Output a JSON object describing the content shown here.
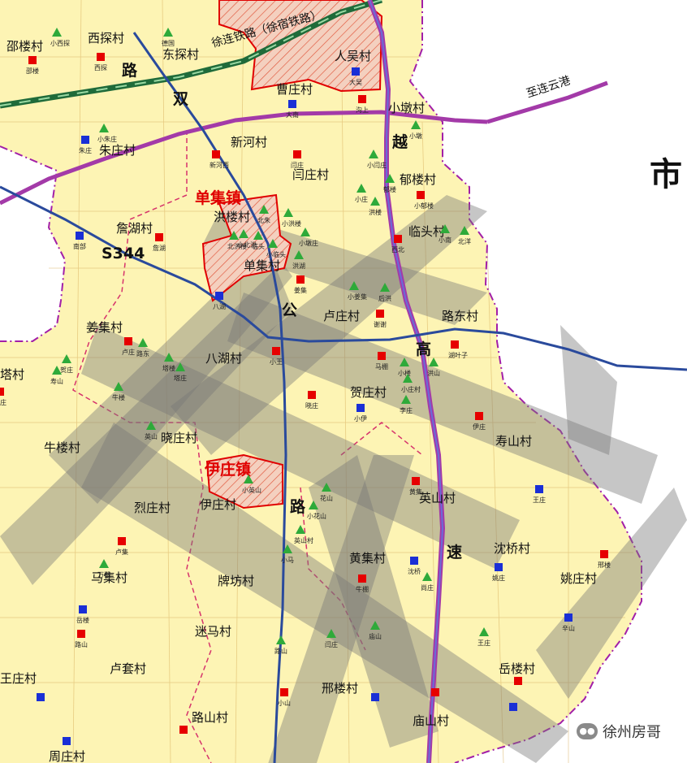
{
  "map": {
    "city_label": "市",
    "road_labels": {
      "shuang": "双",
      "gong1": "公",
      "lu1": "路",
      "gao": "高",
      "su": "速",
      "yue": "越",
      "gong2": "公",
      "lu2": "路",
      "s344": "S344",
      "gangyun": "至连云港",
      "railway": "徐连铁路（徐宿铁路）"
    },
    "towns": [
      "单集镇",
      "伊庄镇"
    ],
    "villages": [
      "邵楼村",
      "西探村",
      "东探村",
      "人吴村",
      "曹庄村",
      "小墩村",
      "朱庄村",
      "新河村",
      "闫庄村",
      "郁楼村",
      "单集镇",
      "洪楼村",
      "詹湖村",
      "临头村",
      "单集村",
      "卢庄村",
      "路东村",
      "姜集村",
      "八湖村",
      "塔村",
      "贺庄村",
      "寿山村",
      "牛楼村",
      "晓庄村",
      "伊庄镇",
      "伊庄村",
      "烈庄村",
      "英山村",
      "黄集村",
      "马集村",
      "沈桥村",
      "姚庄村",
      "牌坊村",
      "迷马村",
      "卢套村",
      "邢楼村",
      "岳楼村",
      "路山村",
      "王庄村",
      "庙山村",
      "周庄村"
    ],
    "small_labels": [
      "邵楼",
      "西探",
      "小西探",
      "德国",
      "大吴",
      "大南",
      "沟上",
      "小墩",
      "朱庄",
      "小朱庄",
      "新河西",
      "闫庄",
      "小闫庄",
      "郁楼",
      "小郁楼",
      "小庄",
      "洪楼",
      "北朱",
      "小洪楼",
      "詹湖",
      "南部",
      "小墩庄",
      "北洪楼",
      "小北洪",
      "临头",
      "小临头",
      "洪湖",
      "西北",
      "小南",
      "北洋",
      "八湖",
      "姜集",
      "小姜集",
      "后洪",
      "谢谢",
      "湖叶子",
      "卢庄",
      "路东",
      "塔楼",
      "塔庄",
      "贺庄",
      "寿山",
      "马棚",
      "小王",
      "小楼",
      "小庄村",
      "洪山",
      "李庄",
      "杨庄",
      "牛楼",
      "晓庄",
      "小伊",
      "伊庄",
      "英山",
      "小英山",
      "黄集",
      "花山",
      "小花山",
      "王庄",
      "卢集",
      "万楼",
      "英山村",
      "小马",
      "沈桥",
      "尚庄",
      "姚庄",
      "牛棚",
      "邢楼",
      "辛山",
      "岳楼",
      "路山",
      "庙山",
      "闫庄",
      "王庄",
      "路山",
      "小山"
    ],
    "watermark": "徐州房哥"
  },
  "colors": {
    "land": "#fdf4b4",
    "outside": "#ffffff",
    "block_line": "#d7a95a",
    "boundary": "#a21fa8",
    "expressway": "#a33aa8",
    "provincial": "#2a4a9c",
    "national": "#1f6b3a",
    "town_red": "#e00000",
    "corridor": "rgba(120,120,120,0.45)",
    "village_red": "#e60000",
    "village_blue": "#1a2fd6",
    "village_green": "#2eaa3a"
  }
}
